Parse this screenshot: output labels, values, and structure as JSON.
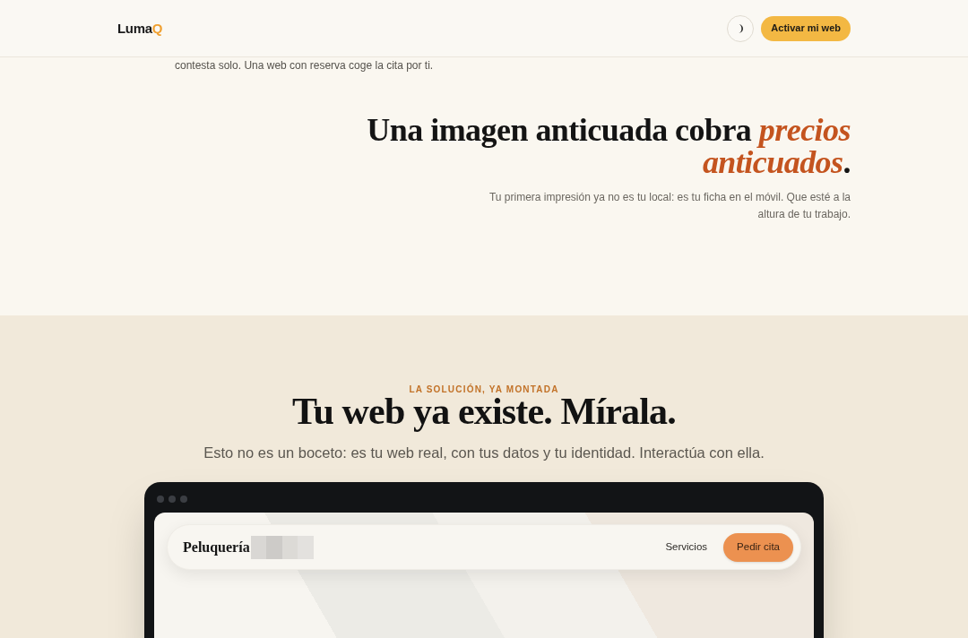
{
  "header": {
    "logo": {
      "text": "Luma",
      "accent": "Q"
    },
    "cta": "Activar mi web"
  },
  "intro": {
    "text": "contesta solo. Una web con reserva coge la cita por ti."
  },
  "problem": {
    "heading": "Una imagen anticuada cobra *precios anticuados*.",
    "text": "Tu primera impresión ya no es tu local: es tu ficha en el móvil. Que esté a la altura de tu trabajo."
  },
  "solution": {
    "eyebrow": "LA SOLUCIÓN, YA MONTADA",
    "heading": "Tu web ya existe. Mírala.",
    "text": "Esto no es un boceto: es tu web real, con tus datos y tu identidad. Interactúa con ella."
  },
  "preview": {
    "brand": "Peluquería",
    "nav": [
      {
        "label": "Servicios",
        "kind": "link"
      },
      {
        "label": "Pedir cita",
        "kind": "button"
      }
    ]
  }
}
